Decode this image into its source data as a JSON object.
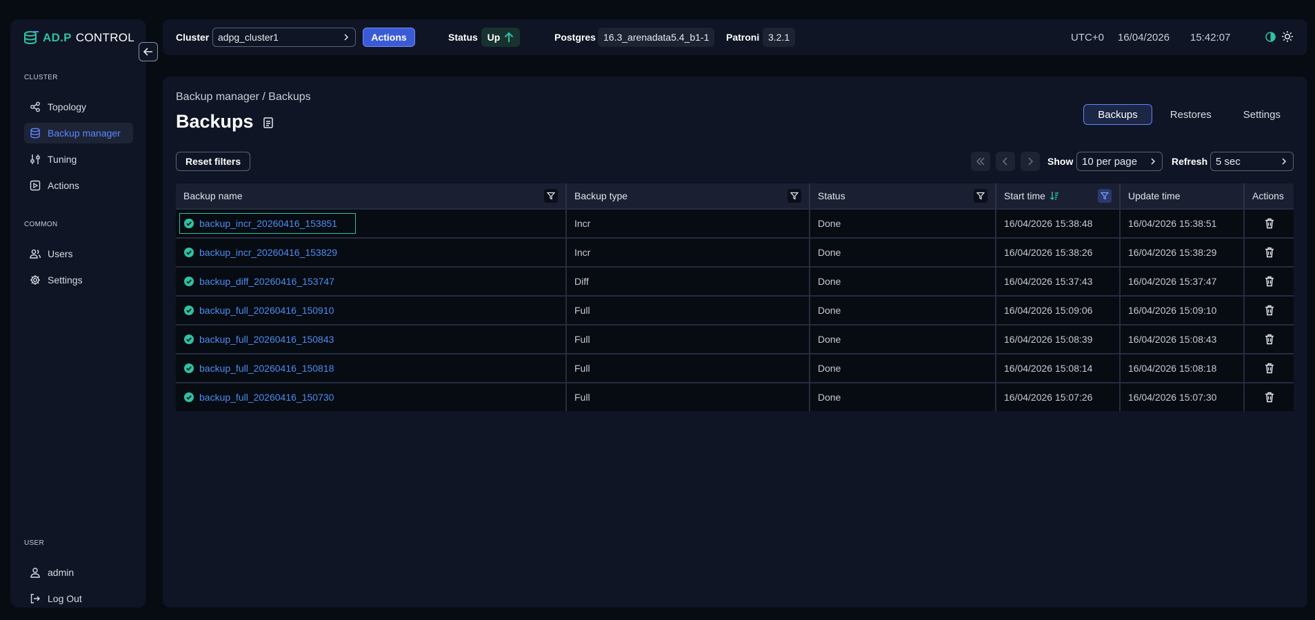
{
  "logo": {
    "brand": "AD.P",
    "product": "CONTROL"
  },
  "sidebar": {
    "cluster_section": "CLUSTER",
    "cluster_items": [
      {
        "label": "Topology",
        "icon": "topology-icon"
      },
      {
        "label": "Backup manager",
        "icon": "database-icon",
        "active": true
      },
      {
        "label": "Tuning",
        "icon": "sliders-icon"
      },
      {
        "label": "Actions",
        "icon": "play-icon"
      }
    ],
    "common_section": "COMMON",
    "common_items": [
      {
        "label": "Users",
        "icon": "users-icon"
      },
      {
        "label": "Settings",
        "icon": "gear-icon"
      }
    ],
    "user_section": "USER",
    "user_items": [
      {
        "label": "admin",
        "icon": "user-icon"
      },
      {
        "label": "Log Out",
        "icon": "logout-icon"
      }
    ]
  },
  "topbar": {
    "cluster_label": "Cluster",
    "cluster_value": "adpg_cluster1",
    "actions_label": "Actions",
    "status_label": "Status",
    "status_value": "Up",
    "postgres_label": "Postgres",
    "postgres_value": "16.3_arenadata5.4_b1-1",
    "patroni_label": "Patroni",
    "patroni_value": "3.2.1",
    "timezone": "UTC+0",
    "date": "16/04/2026",
    "time": "15:42:07"
  },
  "main": {
    "breadcrumb": "Backup manager / Backups",
    "title": "Backups",
    "tabs": [
      {
        "label": "Backups",
        "active": true
      },
      {
        "label": "Restores"
      },
      {
        "label": "Settings"
      }
    ],
    "reset_filters": "Reset filters",
    "show_label": "Show",
    "per_page": "10 per page",
    "refresh_label": "Refresh",
    "refresh_value": "5 sec"
  },
  "table": {
    "columns": [
      "Backup name",
      "Backup type",
      "Status",
      "Start time",
      "Update time",
      "Actions"
    ],
    "rows": [
      {
        "name": "backup_incr_20260416_153851",
        "type": "Incr",
        "status": "Done",
        "start": "16/04/2026 15:38:48",
        "update": "16/04/2026 15:38:51"
      },
      {
        "name": "backup_incr_20260416_153829",
        "type": "Incr",
        "status": "Done",
        "start": "16/04/2026 15:38:26",
        "update": "16/04/2026 15:38:29"
      },
      {
        "name": "backup_diff_20260416_153747",
        "type": "Diff",
        "status": "Done",
        "start": "16/04/2026 15:37:43",
        "update": "16/04/2026 15:37:47"
      },
      {
        "name": "backup_full_20260416_150910",
        "type": "Full",
        "status": "Done",
        "start": "16/04/2026 15:09:06",
        "update": "16/04/2026 15:09:10"
      },
      {
        "name": "backup_full_20260416_150843",
        "type": "Full",
        "status": "Done",
        "start": "16/04/2026 15:08:39",
        "update": "16/04/2026 15:08:43"
      },
      {
        "name": "backup_full_20260416_150818",
        "type": "Full",
        "status": "Done",
        "start": "16/04/2026 15:08:14",
        "update": "16/04/2026 15:08:18"
      },
      {
        "name": "backup_full_20260416_150730",
        "type": "Full",
        "status": "Done",
        "start": "16/04/2026 15:07:26",
        "update": "16/04/2026 15:07:30"
      }
    ]
  },
  "colors": {
    "accent": "#5f86ff",
    "success": "#2fc1a2",
    "link": "#4d8df0",
    "background": "#070b12",
    "panel": "#0f1524"
  }
}
